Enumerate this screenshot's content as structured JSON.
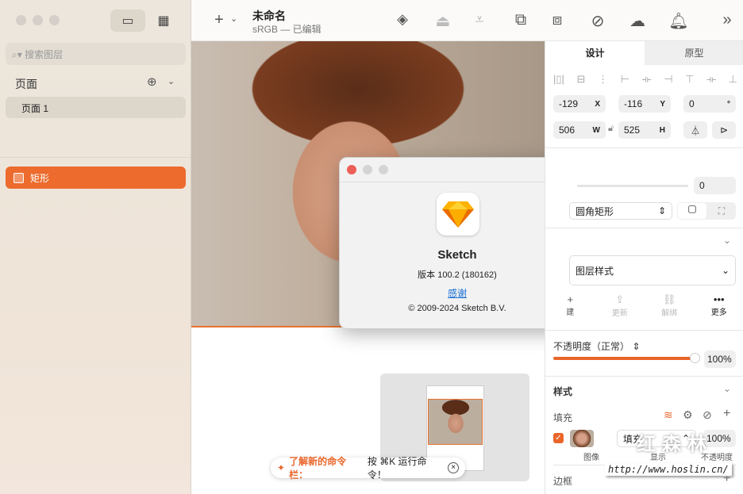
{
  "sidebar": {
    "search_placeholder": "搜索图层",
    "pages_header": "页面",
    "pages": [
      "页面 1"
    ],
    "layers": [
      "矩形"
    ]
  },
  "toolbar": {
    "title": "未命名",
    "subtitle": "sRGB — 已编辑"
  },
  "dialog": {
    "app_name": "Sketch",
    "version": "版本 100.2 (180162)",
    "thanks_link": "感谢",
    "copyright": "© 2009-2024 Sketch B.V."
  },
  "hint": {
    "label": "了解新的命令栏：",
    "text": "按 ⌘K 运行命令！"
  },
  "inspector": {
    "tabs": [
      "设计",
      "原型"
    ],
    "x": "-129",
    "x_label": "X",
    "y": "-116",
    "y_label": "Y",
    "rotation": "0",
    "rotation_unit": "°",
    "w": "506",
    "w_label": "W",
    "h": "525",
    "h_label": "H",
    "radius": "0",
    "corner_type": "圆角矩形",
    "layer_style": "图层样式",
    "style_actions": [
      "建",
      "更新",
      "解绑",
      "更多"
    ],
    "opacity_label": "不透明度（正常）",
    "opacity": "100%",
    "opacity_value": 1.0,
    "style_section": "样式",
    "fill_label": "填充",
    "fill_type": "填充",
    "fill_opacity": "100%",
    "fill_captions": [
      "图像",
      "显示",
      "不透明度"
    ],
    "border_label": "边框"
  },
  "watermark": {
    "text": "红森林",
    "url": "http://www.hoslin.cn/"
  },
  "colors": {
    "accent": "#ec6b2d"
  }
}
